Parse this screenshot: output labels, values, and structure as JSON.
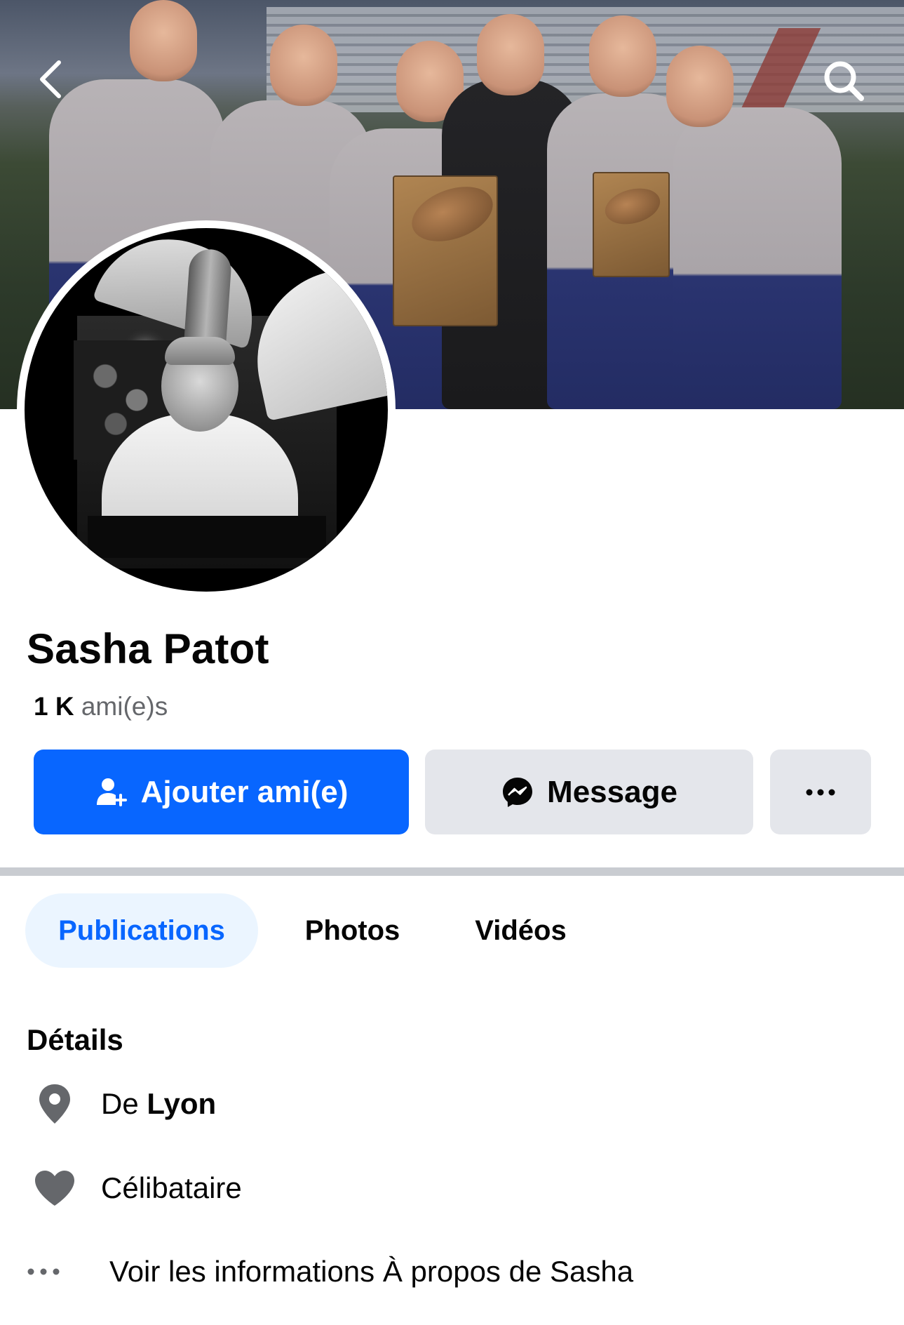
{
  "navigation": {
    "back_icon": "chevron-left-icon",
    "search_icon": "search-icon"
  },
  "profile": {
    "name": "Sasha Patot",
    "friends_count": "1 K",
    "friends_label": "ami(e)s"
  },
  "actions": {
    "add_friend_label": "Ajouter ami(e)",
    "add_friend_icon": "user-plus-icon",
    "message_label": "Message",
    "message_icon": "messenger-icon",
    "more_label": "···",
    "more_icon": "more-dots-icon"
  },
  "tabs": [
    {
      "label": "Publications",
      "active": true
    },
    {
      "label": "Photos",
      "active": false
    },
    {
      "label": "Vidéos",
      "active": false
    }
  ],
  "details": {
    "title": "Détails",
    "city_prefix": "De",
    "city": "Lyon",
    "relationship": "Célibataire",
    "about_link": "Voir les informations À propos de Sasha"
  },
  "colors": {
    "primary_blue": "#0866ff",
    "secondary_button": "#e4e6eb",
    "active_tab_bg": "#ebf5ff",
    "muted_text": "#65676b",
    "icon_gray": "#65676b"
  }
}
